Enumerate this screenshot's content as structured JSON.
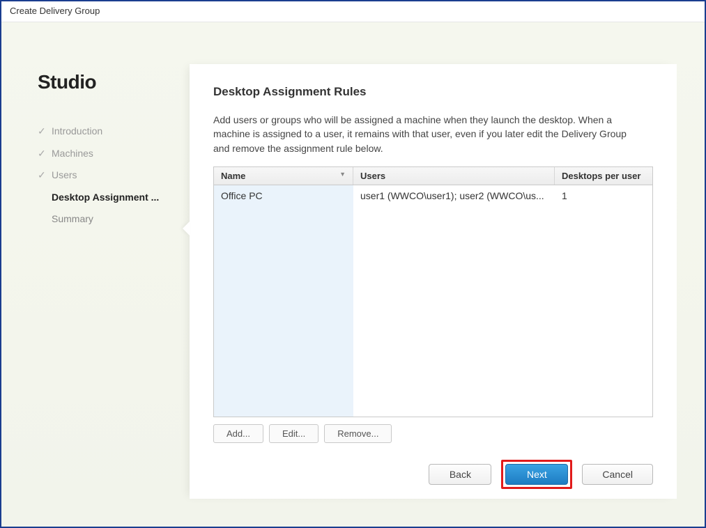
{
  "window": {
    "title": "Create Delivery Group"
  },
  "brand": "Studio",
  "nav": {
    "items": [
      {
        "label": "Introduction",
        "done": true
      },
      {
        "label": "Machines",
        "done": true
      },
      {
        "label": "Users",
        "done": true
      },
      {
        "label": "Desktop Assignment ...",
        "current": true
      },
      {
        "label": "Summary"
      }
    ]
  },
  "main": {
    "title": "Desktop Assignment Rules",
    "description": "Add users or groups who will be assigned a machine when they launch the desktop. When a machine is assigned to a user, it remains with that user, even if you later edit the Delivery Group and remove the assignment rule below.",
    "table": {
      "columns": {
        "name": "Name",
        "users": "Users",
        "desktops": "Desktops per user"
      },
      "rows": [
        {
          "name": "Office PC",
          "users": "user1 (WWCO\\user1); user2 (WWCO\\us...",
          "desktops": "1"
        }
      ]
    },
    "buttons": {
      "add": "Add...",
      "edit": "Edit...",
      "remove": "Remove..."
    }
  },
  "wizard": {
    "back": "Back",
    "next": "Next",
    "cancel": "Cancel"
  }
}
